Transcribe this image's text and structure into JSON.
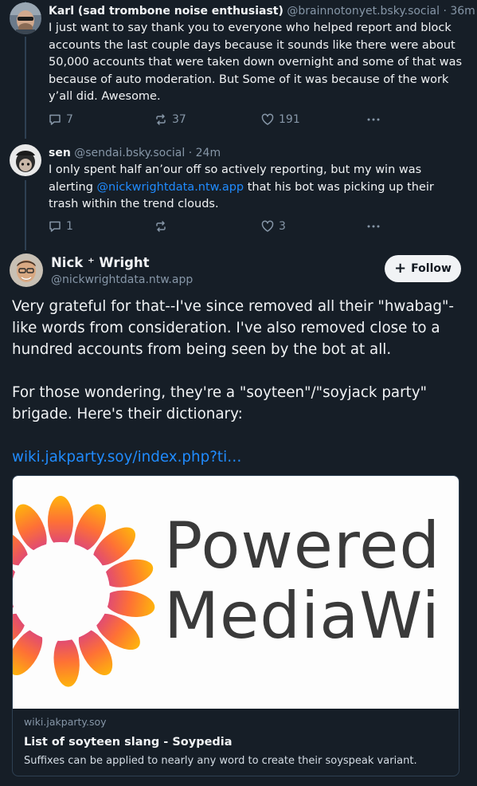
{
  "replies": [
    {
      "display_name": "Karl (sad trombone noise enthusiast)",
      "handle": "@brainnotonyet.bsky.social",
      "separator": "·",
      "time": "36m",
      "text": "I just want to say thank you to everyone who helped report and block accounts the last couple days because it sounds like there were about 50,000 accounts that were taken down overnight and some of that was because of auto moderation. But Some of it was because of the work y’all did. Awesome.",
      "reply_count": "7",
      "repost_count": "37",
      "like_count": "191"
    },
    {
      "display_name": "sen",
      "handle": "@sendai.bsky.social",
      "separator": "·",
      "time": "24m",
      "text_before": "I only spent half an’our off so actively reporting, but my win was alerting ",
      "mention": "@nickwrightdata.ntw.app",
      "text_after": " that his bot was picking up their trash within the trend clouds.",
      "reply_count": "1",
      "repost_count": "",
      "like_count": "3"
    }
  ],
  "main_post": {
    "display_name": "Nick ⁺ Wright",
    "handle": "@nickwrightdata.ntw.app",
    "follow_label": "Follow",
    "follow_icon": "plus",
    "paragraph1": "Very grateful for that--I've since removed all their \"hwabag\"-like words from consideration. I've also removed close to a hundred accounts from being seen by the bot at all.",
    "paragraph2": "For those wondering, they're a \"soyteen\"/\"soyjack party\" brigade. Here's their dictionary:",
    "link": "wiki.jakparty.soy/index.php?ti…"
  },
  "link_card": {
    "image_text_line1": "Powered b",
    "image_text_line2": "MediaWi",
    "domain": "wiki.jakparty.soy",
    "title": "List of soyteen slang - Soypedia",
    "description": "Suffixes can be applied to nearly any word to create their soyspeak variant."
  },
  "icons": [
    "reply-icon",
    "repost-icon",
    "like-icon",
    "more-icon",
    "plus-icon"
  ],
  "colors": {
    "background": "#161e27",
    "text": "#f1f3f5",
    "muted": "#8696a7",
    "link": "#208bfe",
    "thread_line": "#2e4052"
  }
}
